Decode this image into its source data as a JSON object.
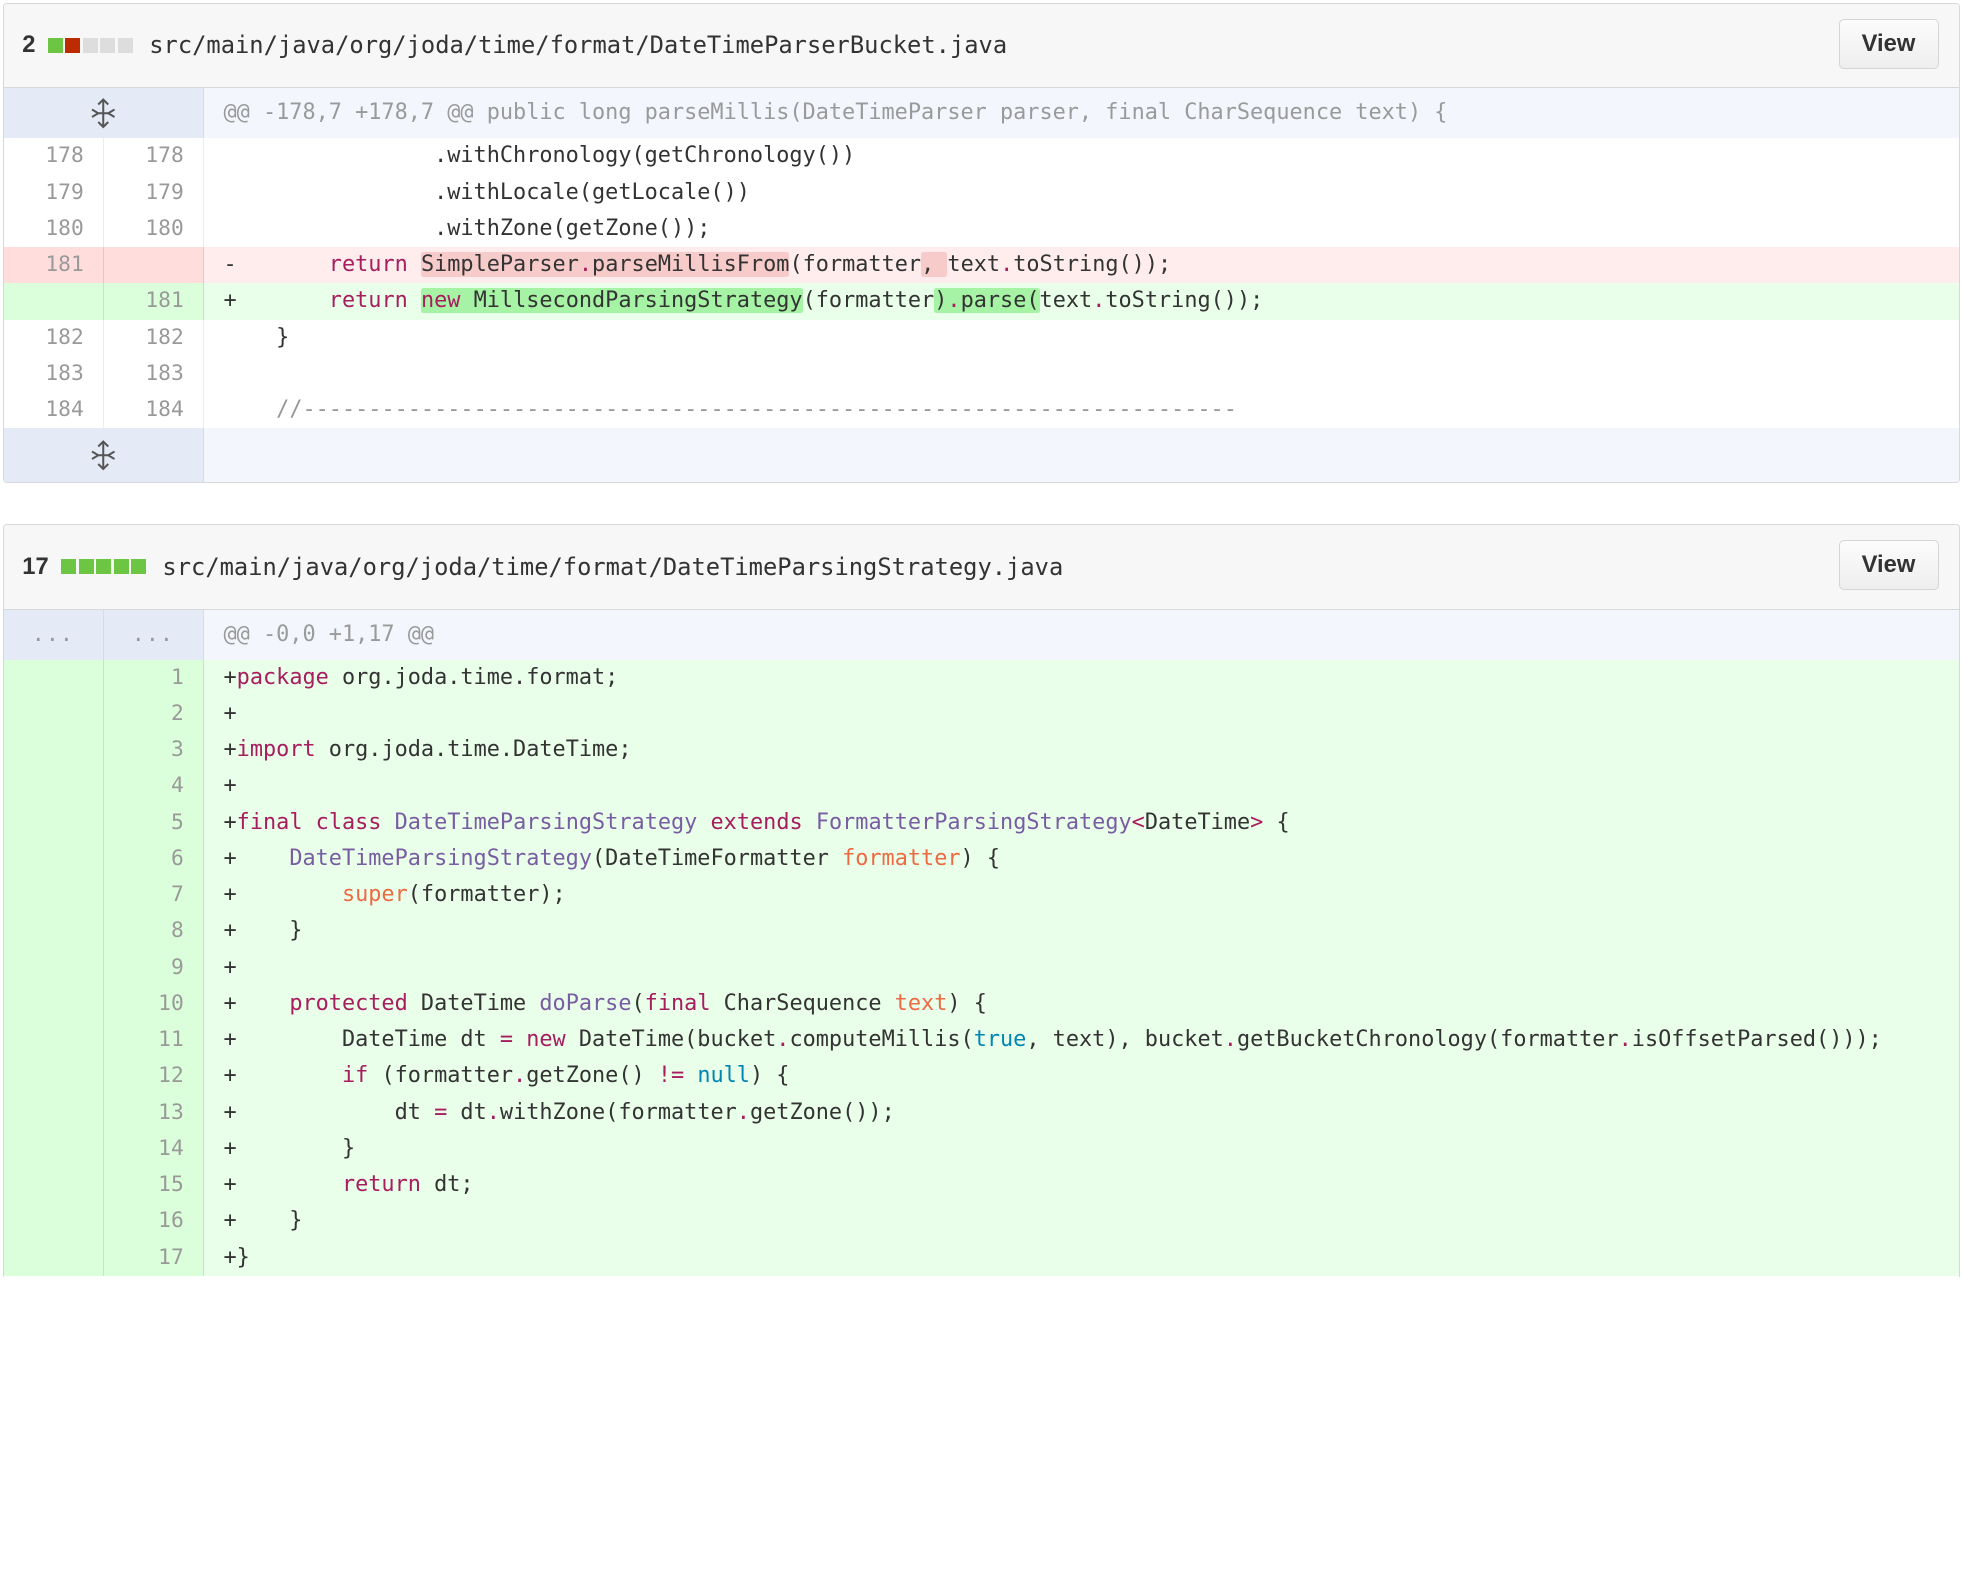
{
  "files": [
    {
      "count": "2",
      "path": "src/main/java/org/joda/time/format/DateTimeParserBucket.java",
      "view_label": "View",
      "hunk": "@@ -178,7 +178,7 @@ public long parseMillis(DateTimeParser parser, final CharSequence text) {",
      "lines": [
        {
          "old": "178",
          "new": "178"
        },
        {
          "old": "179",
          "new": "179"
        },
        {
          "old": "180",
          "new": "180"
        },
        {
          "old": "181",
          "new": ""
        },
        {
          "old": "",
          "new": "181"
        },
        {
          "old": "182",
          "new": "182"
        },
        {
          "old": "183",
          "new": "183"
        },
        {
          "old": "184",
          "new": "184"
        }
      ]
    },
    {
      "count": "17",
      "path": "src/main/java/org/joda/time/format/DateTimeParsingStrategy.java",
      "view_label": "View",
      "hunk_old": "...",
      "hunk_new": "...",
      "hunk": "@@ -0,0 +1,17 @@",
      "lines": [
        "1",
        "2",
        "3",
        "4",
        "5",
        "6",
        "7",
        "8",
        "9",
        "10",
        "11",
        "12",
        "13",
        "14",
        "15",
        "16",
        "17"
      ]
    }
  ],
  "colors": {
    "addition": "#6cc644",
    "deletion": "#bd2c00",
    "neutral": "#dddddd",
    "keyword": "#a71d5d",
    "type": "#795da3",
    "variable": "#ed6a43",
    "constant": "#0086b3"
  },
  "icons": {
    "expand": "unfold-expand-icon"
  }
}
